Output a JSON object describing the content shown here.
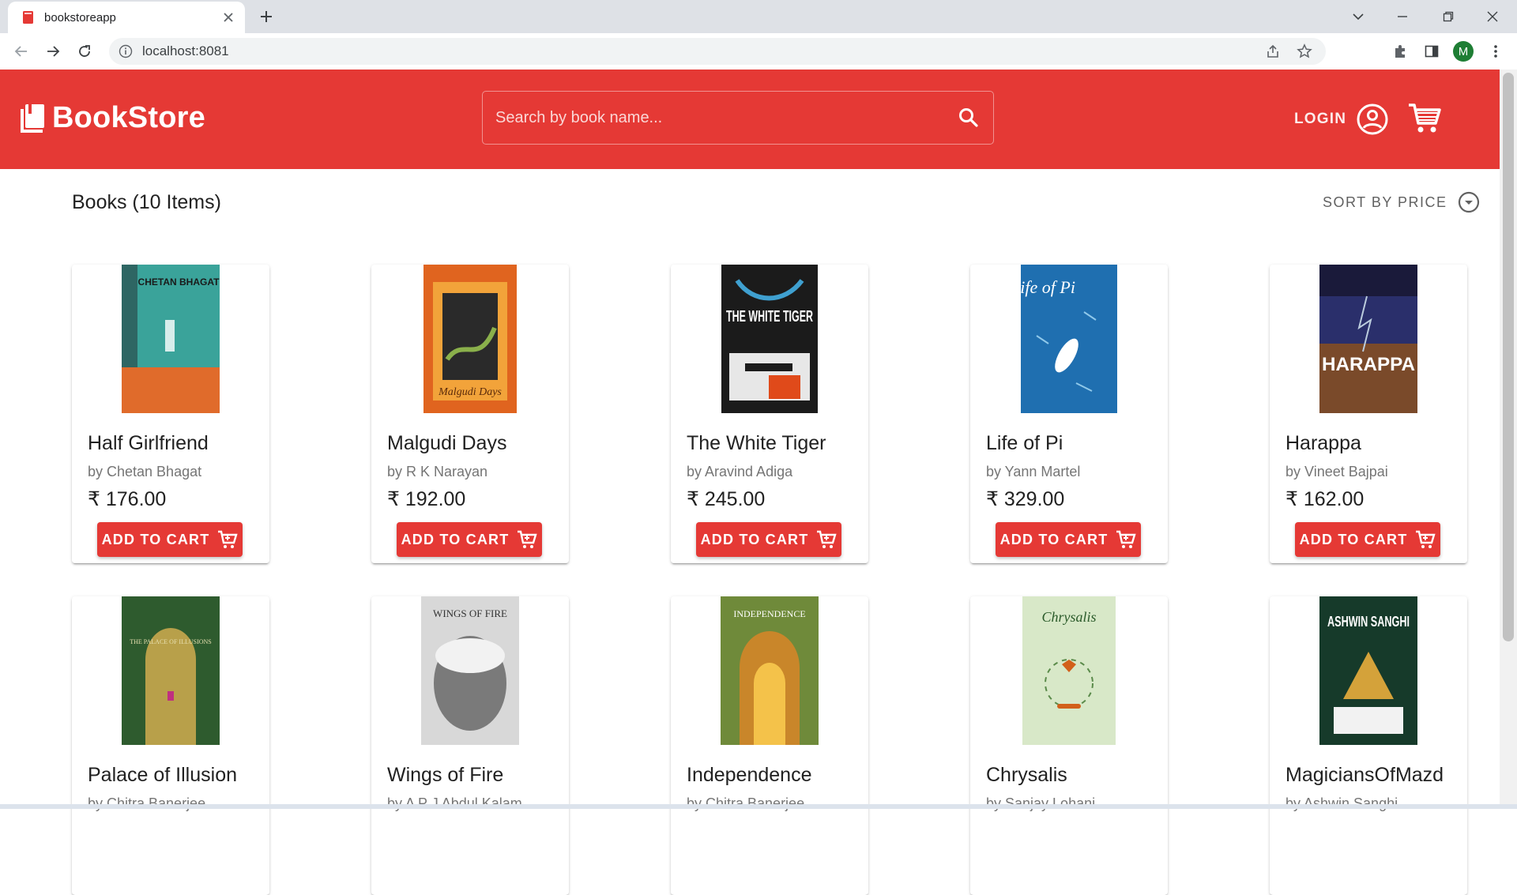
{
  "browser": {
    "tab_title": "bookstoreapp",
    "url": "localhost:8081",
    "profile_initial": "M"
  },
  "header": {
    "brand": "BookStore",
    "search_placeholder": "Search by book name...",
    "login_label": "LOGIN",
    "accent_color": "#e53935"
  },
  "listing": {
    "title": "Books (10 Items)",
    "sort_label": "SORT BY PRICE",
    "add_to_cart_label": "ADD TO CART"
  },
  "books": [
    {
      "title": "Half Girlfriend",
      "author": "by Chetan Bhagat",
      "price": "₹ 176.00",
      "cover_text": "CHETAN BHAGAT",
      "cover_color": "#3aa39a"
    },
    {
      "title": "Malgudi Days",
      "author": "by R K Narayan",
      "price": "₹ 192.00",
      "cover_text": "Malgudi Days",
      "cover_color": "#e0641f"
    },
    {
      "title": "The White Tiger",
      "author": "by Aravind Adiga",
      "price": "₹ 245.00",
      "cover_text": "THE WHITE TIGER",
      "cover_color": "#1b1b1b"
    },
    {
      "title": "Life of Pi",
      "author": "by Yann Martel",
      "price": "₹ 329.00",
      "cover_text": "Life of Pi",
      "cover_color": "#1f6fb0"
    },
    {
      "title": "Harappa",
      "author": "by Vineet Bajpai",
      "price": "₹ 162.00",
      "cover_text": "HARAPPA",
      "cover_color": "#2a2f6b"
    },
    {
      "title": "Palace of Illusion",
      "author": "by Chitra Banerjee",
      "price": "",
      "cover_text": "THE PALACE OF ILLUSIONS",
      "cover_color": "#2e5b2e"
    },
    {
      "title": "Wings of Fire",
      "author": "by A P J Abdul Kalam",
      "price": "",
      "cover_text": "WINGS OF FIRE",
      "cover_color": "#9a9a9a"
    },
    {
      "title": "Independence",
      "author": "by Chitra Banerjee",
      "price": "",
      "cover_text": "INDEPENDENCE",
      "cover_color": "#6f8a3a"
    },
    {
      "title": "Chrysalis",
      "author": "by Sanjay Lohani",
      "price": "",
      "cover_text": "Chrysalis",
      "cover_color": "#d8e8c8"
    },
    {
      "title": "MagiciansOfMazd",
      "author": "by Ashwin Sanghi",
      "price": "",
      "cover_text": "ASHWIN SANGHI",
      "cover_color": "#163a2a"
    }
  ]
}
